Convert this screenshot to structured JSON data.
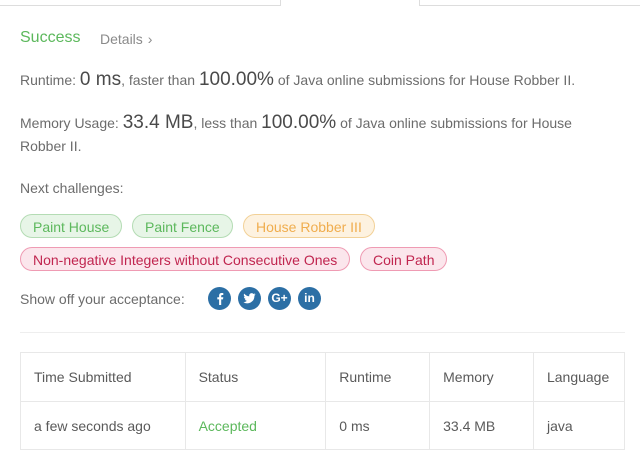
{
  "result": {
    "status": "Success",
    "details_label": "Details",
    "chevron_glyph": "›"
  },
  "runtime": {
    "prefix": "Runtime: ",
    "value": "0 ms",
    "middle": ", faster than ",
    "percent": "100.00%",
    "suffix": " of Java online submissions for House Robber II."
  },
  "memory": {
    "prefix": "Memory Usage: ",
    "value": "33.4 MB",
    "middle": ", less than ",
    "percent": "100.00%",
    "suffix": " of Java online submissions for House Robber II."
  },
  "challenges": {
    "label": "Next challenges:",
    "items": [
      {
        "label": "Paint House",
        "difficulty": "easy"
      },
      {
        "label": "Paint Fence",
        "difficulty": "easy"
      },
      {
        "label": "House Robber III",
        "difficulty": "medium"
      },
      {
        "label": "Non-negative Integers without Consecutive Ones",
        "difficulty": "hard"
      },
      {
        "label": "Coin Path",
        "difficulty": "hard"
      }
    ]
  },
  "share": {
    "label": "Show off your acceptance:",
    "icons": [
      "facebook-icon",
      "twitter-icon",
      "google-plus-icon",
      "linkedin-icon"
    ],
    "glyphs": {
      "google_plus": "G+",
      "linkedin": "in"
    }
  },
  "submissions": {
    "headers": [
      "Time Submitted",
      "Status",
      "Runtime",
      "Memory",
      "Language"
    ],
    "rows": [
      [
        "a few seconds ago",
        "Accepted",
        "0 ms",
        "33.4 MB",
        "java"
      ]
    ]
  },
  "colors": {
    "success": "#5cb85c",
    "medium": "#f0ad4e",
    "hard": "#c0254f",
    "social": "#2c6fa5"
  }
}
